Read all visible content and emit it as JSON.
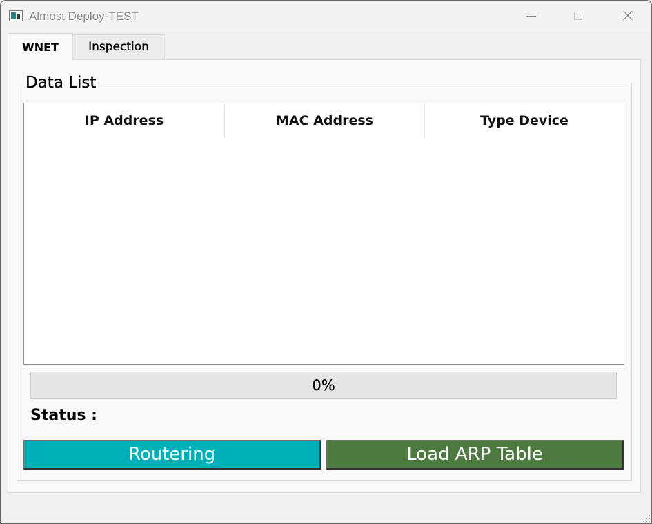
{
  "window": {
    "title": "Almost Deploy-TEST"
  },
  "tabs": [
    {
      "label": "WNET",
      "active": true
    },
    {
      "label": "Inspection",
      "active": false
    }
  ],
  "group": {
    "title": "Data List"
  },
  "table": {
    "columns": [
      "IP Address",
      "MAC Address",
      "Type Device"
    ],
    "rows": []
  },
  "progress": {
    "value": 0,
    "text": "0%"
  },
  "status": {
    "label": "Status :",
    "value": ""
  },
  "buttons": {
    "routering": {
      "label": "Routering",
      "color": "#00b0b8"
    },
    "load_arp": {
      "label": "Load ARP Table",
      "color": "#4e7a41"
    }
  },
  "icons": {
    "app": "app-window-icon",
    "minimize": "minimize-icon",
    "maximize": "maximize-icon",
    "close": "close-icon",
    "grip": "resize-grip-icon"
  }
}
